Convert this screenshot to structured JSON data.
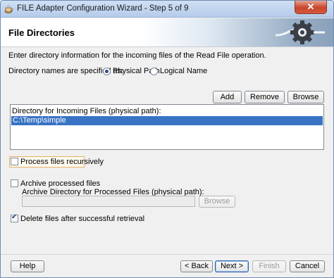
{
  "window": {
    "title": "FILE Adapter Configuration Wizard - Step 5 of 9",
    "close_label": "✕"
  },
  "header": {
    "title": "File Directories"
  },
  "main": {
    "intro": "Enter directory information for the incoming files of the Read File operation.",
    "dir_names_label": "Directory names are specified as:",
    "radio_physical": "Physical Path",
    "radio_logical": "Logical Name",
    "selected_option": "Physical Path",
    "buttons": {
      "add": "Add",
      "remove": "Remove",
      "browse": "Browse"
    },
    "list": {
      "header": "Directory for Incoming Files (physical path):",
      "items": [
        "C:\\Temp\\simple"
      ]
    },
    "process_recursively": {
      "label": "Process files recursively",
      "checked": false
    },
    "archive": {
      "label": "Archive processed files",
      "checked": false
    },
    "archive_dir_label": "Archive Directory for Processed Files (physical path):",
    "archive_dir_value": "",
    "archive_browse": "Browse",
    "delete_after": {
      "label": "Delete files after successful retrieval",
      "checked": true
    }
  },
  "footer": {
    "help": "Help",
    "back": "< Back",
    "next": "Next >",
    "finish": "Finish",
    "cancel": "Cancel"
  }
}
